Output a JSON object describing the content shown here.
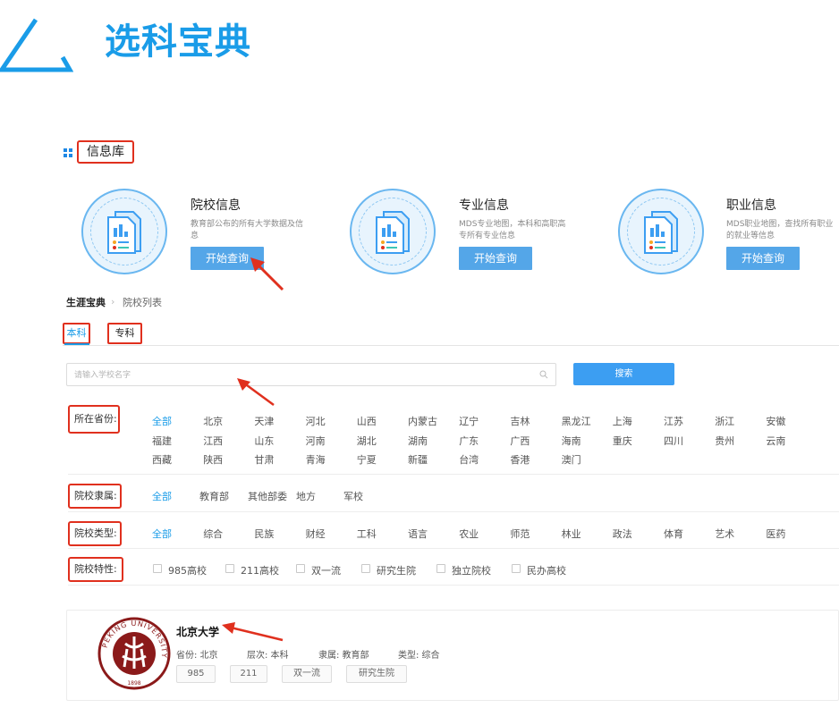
{
  "header": {
    "title": "选科宝典"
  },
  "info_library": {
    "title": "信息库",
    "cards": [
      {
        "title": "院校信息",
        "desc": "教育部公布的所有大学数据及信息",
        "button": "开始查询"
      },
      {
        "title": "专业信息",
        "desc": "MDS专业地图，本科和高职高专所有专业信息",
        "button": "开始查询"
      },
      {
        "title": "职业信息",
        "desc": "MDS职业地图，查找所有职业的就业等信息",
        "button": "开始查询"
      }
    ]
  },
  "breadcrumb": {
    "home": "生涯宝典",
    "separator": "›",
    "current": "院校列表"
  },
  "tabs": [
    "本科",
    "专科"
  ],
  "search": {
    "placeholder": "请输入学校名字",
    "button": "搜索"
  },
  "filters": {
    "province": {
      "label": "所在省份:",
      "options": [
        [
          "全部",
          "北京",
          "天津",
          "河北",
          "山西",
          "内蒙古",
          "辽宁",
          "吉林",
          "黑龙江",
          "上海",
          "江苏",
          "浙江",
          "安徽"
        ],
        [
          "福建",
          "江西",
          "山东",
          "河南",
          "湖北",
          "湖南",
          "广东",
          "广西",
          "海南",
          "重庆",
          "四川",
          "贵州",
          "云南"
        ],
        [
          "西藏",
          "陕西",
          "甘肃",
          "青海",
          "宁夏",
          "新疆",
          "台湾",
          "香港",
          "澳门"
        ]
      ],
      "selected": "全部"
    },
    "affiliation": {
      "label": "院校隶属:",
      "options": [
        "全部",
        "教育部",
        "其他部委",
        "地方",
        "军校"
      ],
      "selected": "全部"
    },
    "type": {
      "label": "院校类型:",
      "options": [
        "全部",
        "综合",
        "民族",
        "财经",
        "工科",
        "语言",
        "农业",
        "师范",
        "林业",
        "政法",
        "体育",
        "艺术",
        "医药"
      ],
      "selected": "全部"
    },
    "feature": {
      "label": "院校特性:",
      "options": [
        "985高校",
        "211高校",
        "双一流",
        "研究生院",
        "独立院校",
        "民办高校"
      ]
    }
  },
  "result": {
    "name": "北京大学",
    "province": "省份: 北京",
    "level": "层次: 本科",
    "affiliation": "隶属: 教育部",
    "type": "类型: 综合",
    "tags": [
      "985",
      "211",
      "双一流",
      "研究生院"
    ],
    "seal_text": "PEKING UNIVERSITY",
    "seal_year": "1898"
  },
  "colors": {
    "accent": "#1a9ce8",
    "annotation": "#e0301e",
    "button": "#54a6e8"
  }
}
